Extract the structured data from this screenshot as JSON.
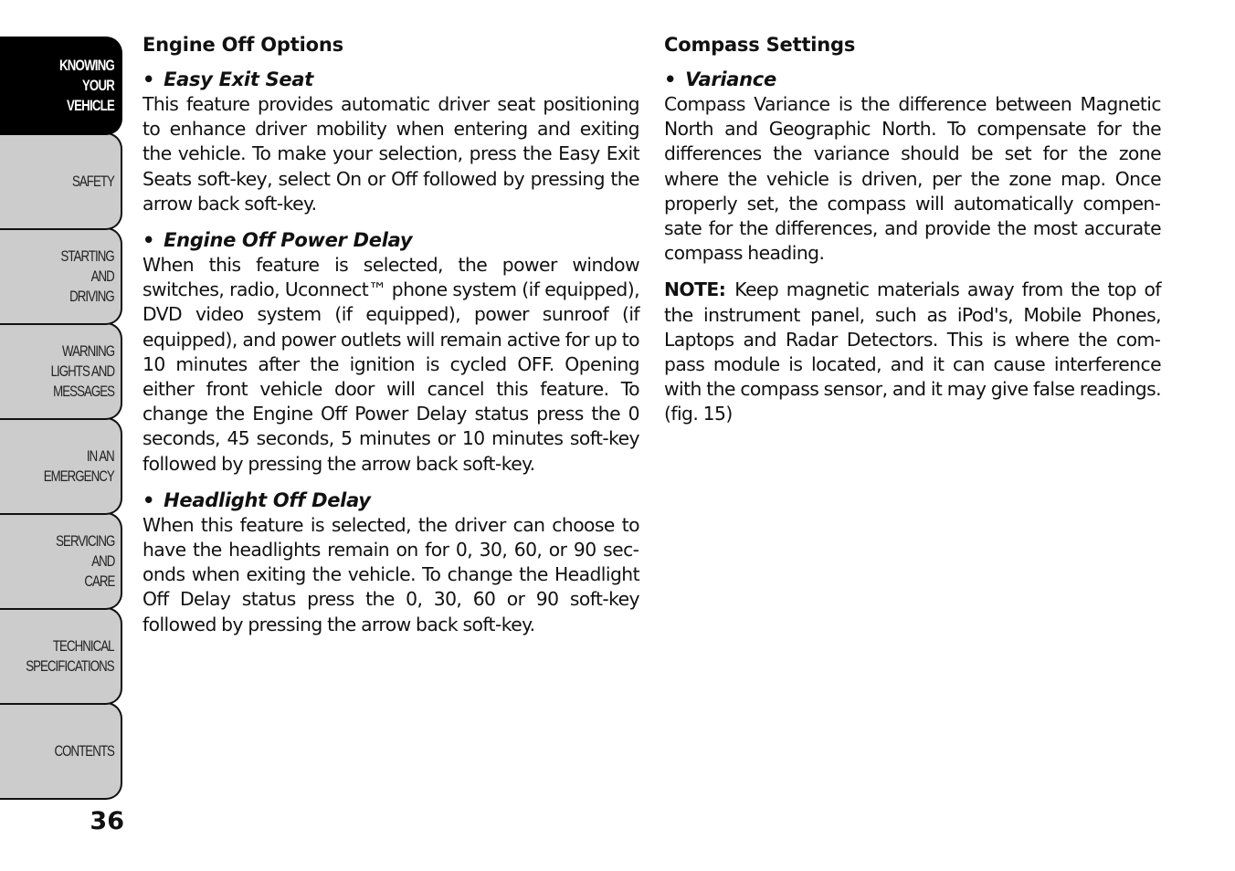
{
  "sidebar": {
    "tabs": [
      {
        "label": "KNOWING\nYOUR\nVEHICLE",
        "active": true
      },
      {
        "label": "SAFETY",
        "active": false
      },
      {
        "label": "STARTING\nAND\nDRIVING",
        "active": false
      },
      {
        "label": "WARNING\nLIGHTS AND\nMESSAGES",
        "active": false
      },
      {
        "label": "IN AN\nEMERGENCY",
        "active": false
      },
      {
        "label": "SERVICING\nAND\nCARE",
        "active": false
      },
      {
        "label": "TECHNICAL\nSPECIFICATIONS",
        "active": false
      },
      {
        "label": "CONTENTS",
        "active": false
      }
    ]
  },
  "page_number": "36",
  "left_column": {
    "heading": "Engine Off Options",
    "sections": [
      {
        "bullet": "•",
        "title": "Easy Exit Seat",
        "body": "This feature provides automatic driver seat positioning to enhance driver mobility when entering and exiting the vehicle. To make your selection, press the Easy Exit Seats soft-key, select On or Off followed by pressing the arrow back soft-key."
      },
      {
        "bullet": "•",
        "title": "Engine Off Power Delay",
        "body": "When this feature is selected, the power window switches, radio, Uconnect™ phone system (if equipped), DVD video system (if equipped), power sunroof (if equipped), and power outlets will remain active for up to 10 minutes after the ignition is cycled OFF. Opening either front vehicle door will cancel this feature. To change the Engine Off Power Delay status press the 0 seconds, 45 seconds, 5 minutes or 10 min­utes soft-key followed by pressing the arrow back soft-key."
      },
      {
        "bullet": "•",
        "title": "Headlight Off Delay",
        "body": "When this feature is selected, the driver can choose to have the headlights remain on for 0, 30, 60, or 90 sec­onds when exiting the vehicle. To change the Headlight Off Delay status press the 0, 30, 60 or 90 soft-key followed by pressing the arrow back soft-key."
      }
    ]
  },
  "right_column": {
    "heading": "Compass Settings",
    "sections": [
      {
        "bullet": "•",
        "title": "Variance",
        "body": "Compass Variance is the difference between Magnetic North and Geographic North. To compensate for the differences the variance should be set for the zone where the vehicle is driven, per the zone map. Once properly set, the compass will automatically compen­sate for the differences, and provide the most accurate compass heading."
      }
    ],
    "note": {
      "label": "NOTE:",
      "text": "Keep magnetic materials away from the top of the instrument panel, such as iPod's, Mobile Phones, Laptops and Radar Detectors. This is where the com­pass module is located, and it can cause interference with the compass sensor, and it may give false readings. (fig.  15)"
    }
  }
}
